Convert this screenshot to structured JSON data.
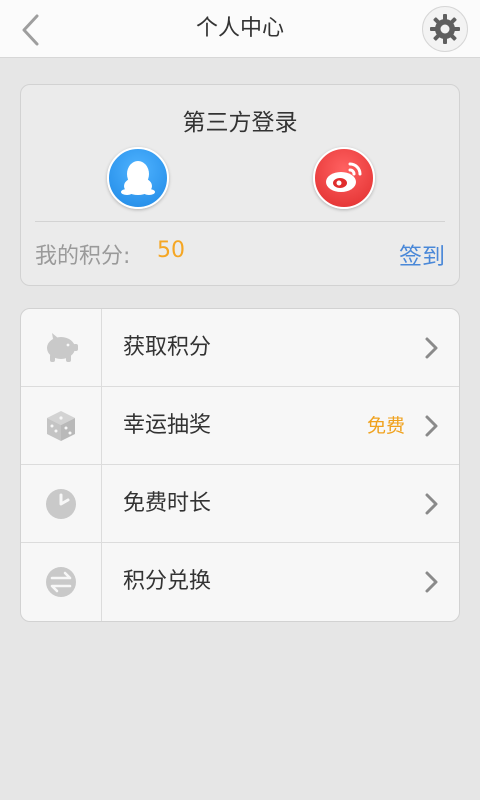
{
  "header": {
    "title": "个人中心",
    "back_icon": "chevron-left-icon",
    "settings_icon": "gear-icon"
  },
  "login": {
    "title": "第三方登录",
    "providers": [
      {
        "name": "QQ",
        "icon": "qq-penguin-icon",
        "color": "#1e88e5"
      },
      {
        "name": "Weibo",
        "icon": "weibo-icon",
        "color": "#e02d2d"
      }
    ],
    "points_label": "我的积分:",
    "points_value": "50",
    "signin_label": "签到"
  },
  "menu": {
    "items": [
      {
        "label": "获取积分",
        "icon": "piggy-bank-icon",
        "badge": ""
      },
      {
        "label": "幸运抽奖",
        "icon": "dice-icon",
        "badge": "免费"
      },
      {
        "label": "免费时长",
        "icon": "clock-icon",
        "badge": ""
      },
      {
        "label": "积分兑换",
        "icon": "exchange-icon",
        "badge": ""
      }
    ]
  },
  "colors": {
    "accent_orange": "#f5a623",
    "link_blue": "#4a88d8",
    "background": "#e6e6e6"
  }
}
